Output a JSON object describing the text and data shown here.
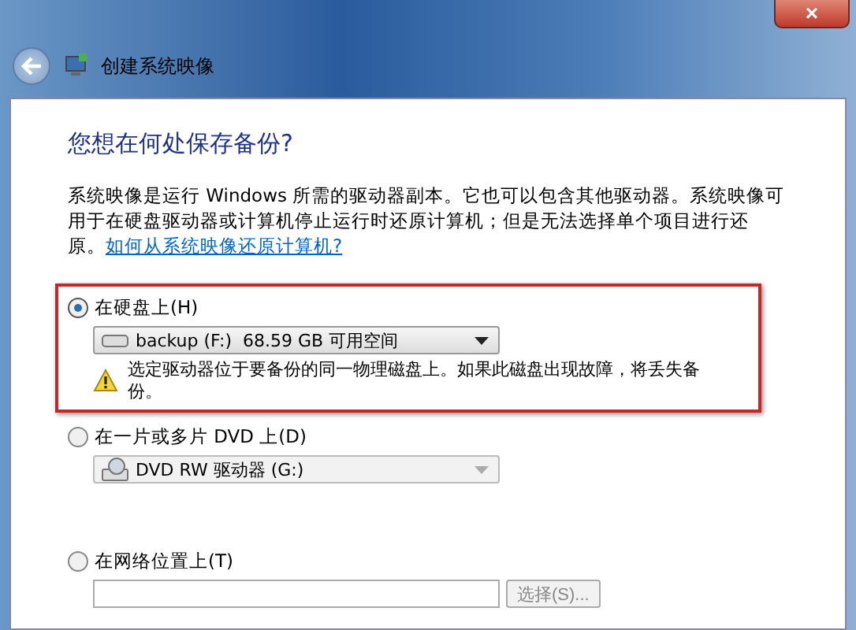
{
  "window": {
    "title": "创建系统映像",
    "close": "×"
  },
  "heading": "您想在何处保存备份?",
  "description": {
    "text": "系统映像是运行 Windows 所需的驱动器副本。它也可以包含其他驱动器。系统映像可用于在硬盘驱动器或计算机停止运行时还原计算机；但是无法选择单个项目进行还原。",
    "link": "如何从系统映像还原计算机?"
  },
  "options": [
    {
      "kind": "drive",
      "label": "在硬盘上(H)",
      "selected": true,
      "highlighted": true,
      "disabled": false,
      "value": "backup (F:)  68.59 GB 可用空间",
      "warning": "选定驱动器位于要备份的同一物理磁盘上。如果此磁盘出现故障，将丢失备份。"
    },
    {
      "kind": "dvd",
      "label": "在一片或多片 DVD 上(D)",
      "selected": false,
      "highlighted": false,
      "disabled": true,
      "value": "DVD RW 驱动器 (G:)"
    },
    {
      "kind": "network",
      "label": "在网络位置上(T)",
      "selected": false,
      "highlighted": false,
      "disabled": true,
      "button": "选择(S)..."
    }
  ]
}
